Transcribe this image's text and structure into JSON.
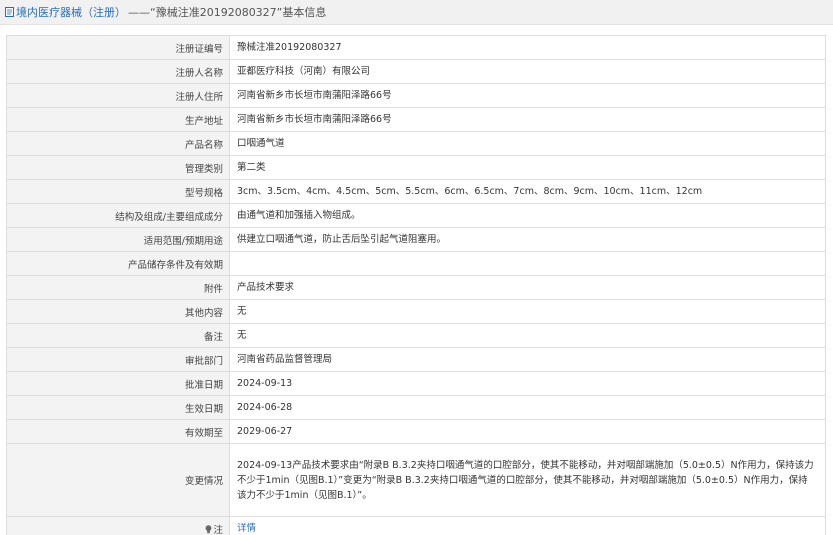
{
  "header": {
    "link_text": "境内医疗器械（注册）",
    "title_text": "——“豫械注准20192080327”基本信息"
  },
  "rows": [
    {
      "label": "注册证编号",
      "value": "豫械注准20192080327"
    },
    {
      "label": "注册人名称",
      "value": "亚都医疗科技（河南）有限公司"
    },
    {
      "label": "注册人住所",
      "value": "河南省新乡市长垣市南蒲阳泽路66号"
    },
    {
      "label": "生产地址",
      "value": "河南省新乡市长垣市南蒲阳泽路66号"
    },
    {
      "label": "产品名称",
      "value": "口咽通气道"
    },
    {
      "label": "管理类别",
      "value": "第二类"
    },
    {
      "label": "型号规格",
      "value": "3cm、3.5cm、4cm、4.5cm、5cm、5.5cm、6cm、6.5cm、7cm、8cm、9cm、10cm、11cm、12cm"
    },
    {
      "label": "结构及组成/主要组成成分",
      "value": "由通气道和加强插入物组成。"
    },
    {
      "label": "适用范围/预期用途",
      "value": "供建立口咽通气道，防止舌后坠引起气道阻塞用。"
    },
    {
      "label": "产品储存条件及有效期",
      "value": ""
    },
    {
      "label": "附件",
      "value": "产品技术要求"
    },
    {
      "label": "其他内容",
      "value": "无"
    },
    {
      "label": "备注",
      "value": "无"
    },
    {
      "label": "审批部门",
      "value": "河南省药品监督管理局"
    },
    {
      "label": "批准日期",
      "value": "2024-09-13"
    },
    {
      "label": "生效日期",
      "value": "2024-06-28"
    },
    {
      "label": "有效期至",
      "value": "2029-06-27"
    },
    {
      "label": "变更情况",
      "value": "2024-09-13产品技术要求由“附录B B.3.2夹持口咽通气道的口腔部分，使其不能移动，并对咽部端施加（5.0±0.5）N作用力，保持该力不少于1min（见图B.1）”变更为“附录B B.3.2夹持口咽通气道的口腔部分，使其不能移动，并对咽部端施加（5.0±0.5）N作用力，保持该力不少于1min（见图B.1）”。"
    }
  ],
  "note": {
    "label": "注",
    "link_text": "详情",
    "icon": "lightbulb-icon"
  }
}
